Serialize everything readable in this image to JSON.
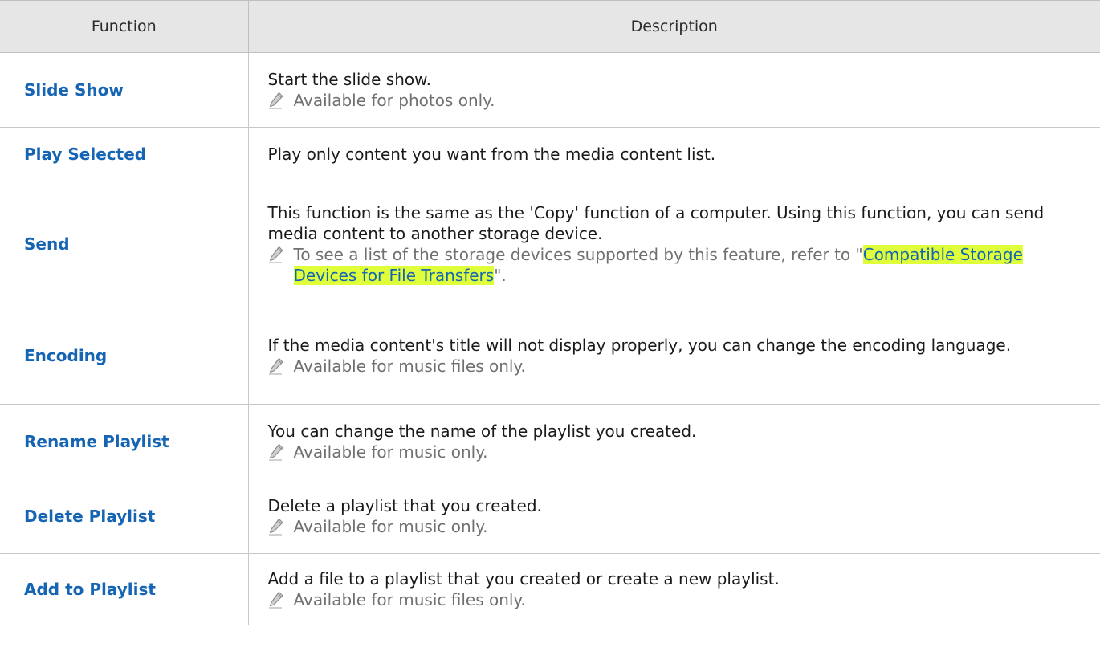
{
  "table": {
    "headers": {
      "function": "Function",
      "description": "Description"
    },
    "rows": [
      {
        "function": "Slide Show",
        "description": "Start the slide show.",
        "note": "Available for photos only."
      },
      {
        "function": "Play Selected",
        "description": "Play only content you want from the media content list."
      },
      {
        "function": "Send",
        "description": "This function is the same as the 'Copy' function of a computer. Using this function, you can send media content to another storage device.",
        "note_prefix": "To see a list of the storage devices supported by this feature, refer to \"",
        "note_link": "Compatible Storage Devices for File Transfers",
        "note_suffix": "\"."
      },
      {
        "function": "Encoding",
        "description": "If the media content's title will not display properly, you can change the encoding language.",
        "note": "Available for music files only."
      },
      {
        "function": "Rename Playlist",
        "description": "You can change the name of the playlist you created.",
        "note": "Available for music only."
      },
      {
        "function": "Delete Playlist",
        "description": "Delete a playlist that you created.",
        "note": "Available for music only."
      },
      {
        "function": "Add to Playlist",
        "description": "Add a file to a playlist that you created or create a new playlist.",
        "note": "Available for music files only."
      }
    ]
  },
  "icons": {
    "note_icon": "pencil-note-icon"
  },
  "colors": {
    "function_text": "#1565b4",
    "note_text": "#707070",
    "link_highlight": "#dfff3a",
    "header_bg": "#e6e6e6"
  }
}
